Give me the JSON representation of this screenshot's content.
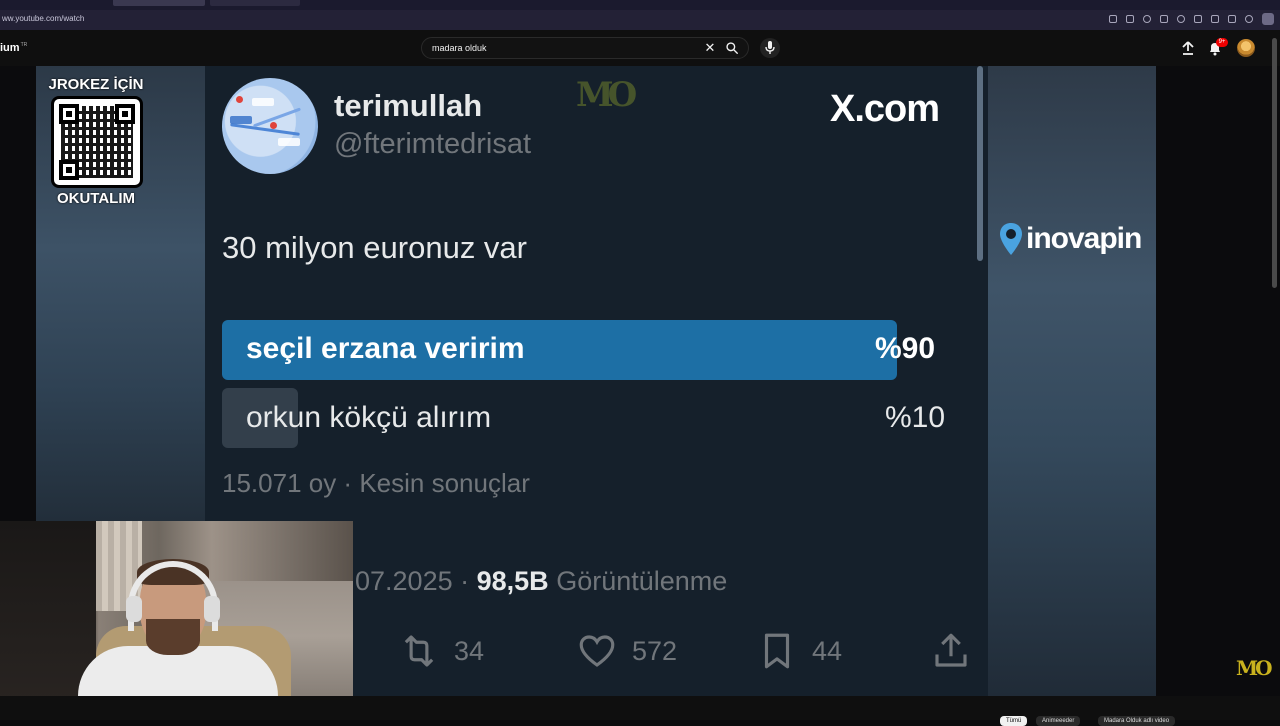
{
  "browser": {
    "url": "ww.youtube.com/watch"
  },
  "youtube": {
    "logo_text": "ium",
    "logo_region": "TR",
    "search_value": "madara olduk",
    "notification_count": "9+"
  },
  "overlay": {
    "qr_top_text": "JROKEZ İÇİN",
    "qr_bottom_text": "OKUTALIM",
    "sponsor_text": "inovapin",
    "watermark_text": "MO"
  },
  "tweet": {
    "display_name": "terimullah",
    "handle": "@fterimtedrisat",
    "source_logo": "X.com",
    "text": "30 milyon euronuz var",
    "poll": {
      "options": [
        {
          "label": "seçil erzana veririm",
          "percent_text": "%90",
          "percent": 90
        },
        {
          "label": "orkun kökçü alırım",
          "percent_text": "%10",
          "percent": 10
        }
      ],
      "meta": "15.071 oy · Kesin sonuçlar"
    },
    "date_partial": "07.2025 ·",
    "views": "98,5B",
    "views_label": "Görüntülenme",
    "stats": {
      "retweets": "34",
      "likes": "572",
      "bookmarks": "44"
    }
  },
  "bottom_chips": [
    "Tümü",
    "Animeeeder",
    "Madara Olduk adlı video"
  ],
  "colors": {
    "tweet_bg": "#15202b",
    "poll_winner": "#1d6fa5",
    "muted_text": "#71767b"
  }
}
